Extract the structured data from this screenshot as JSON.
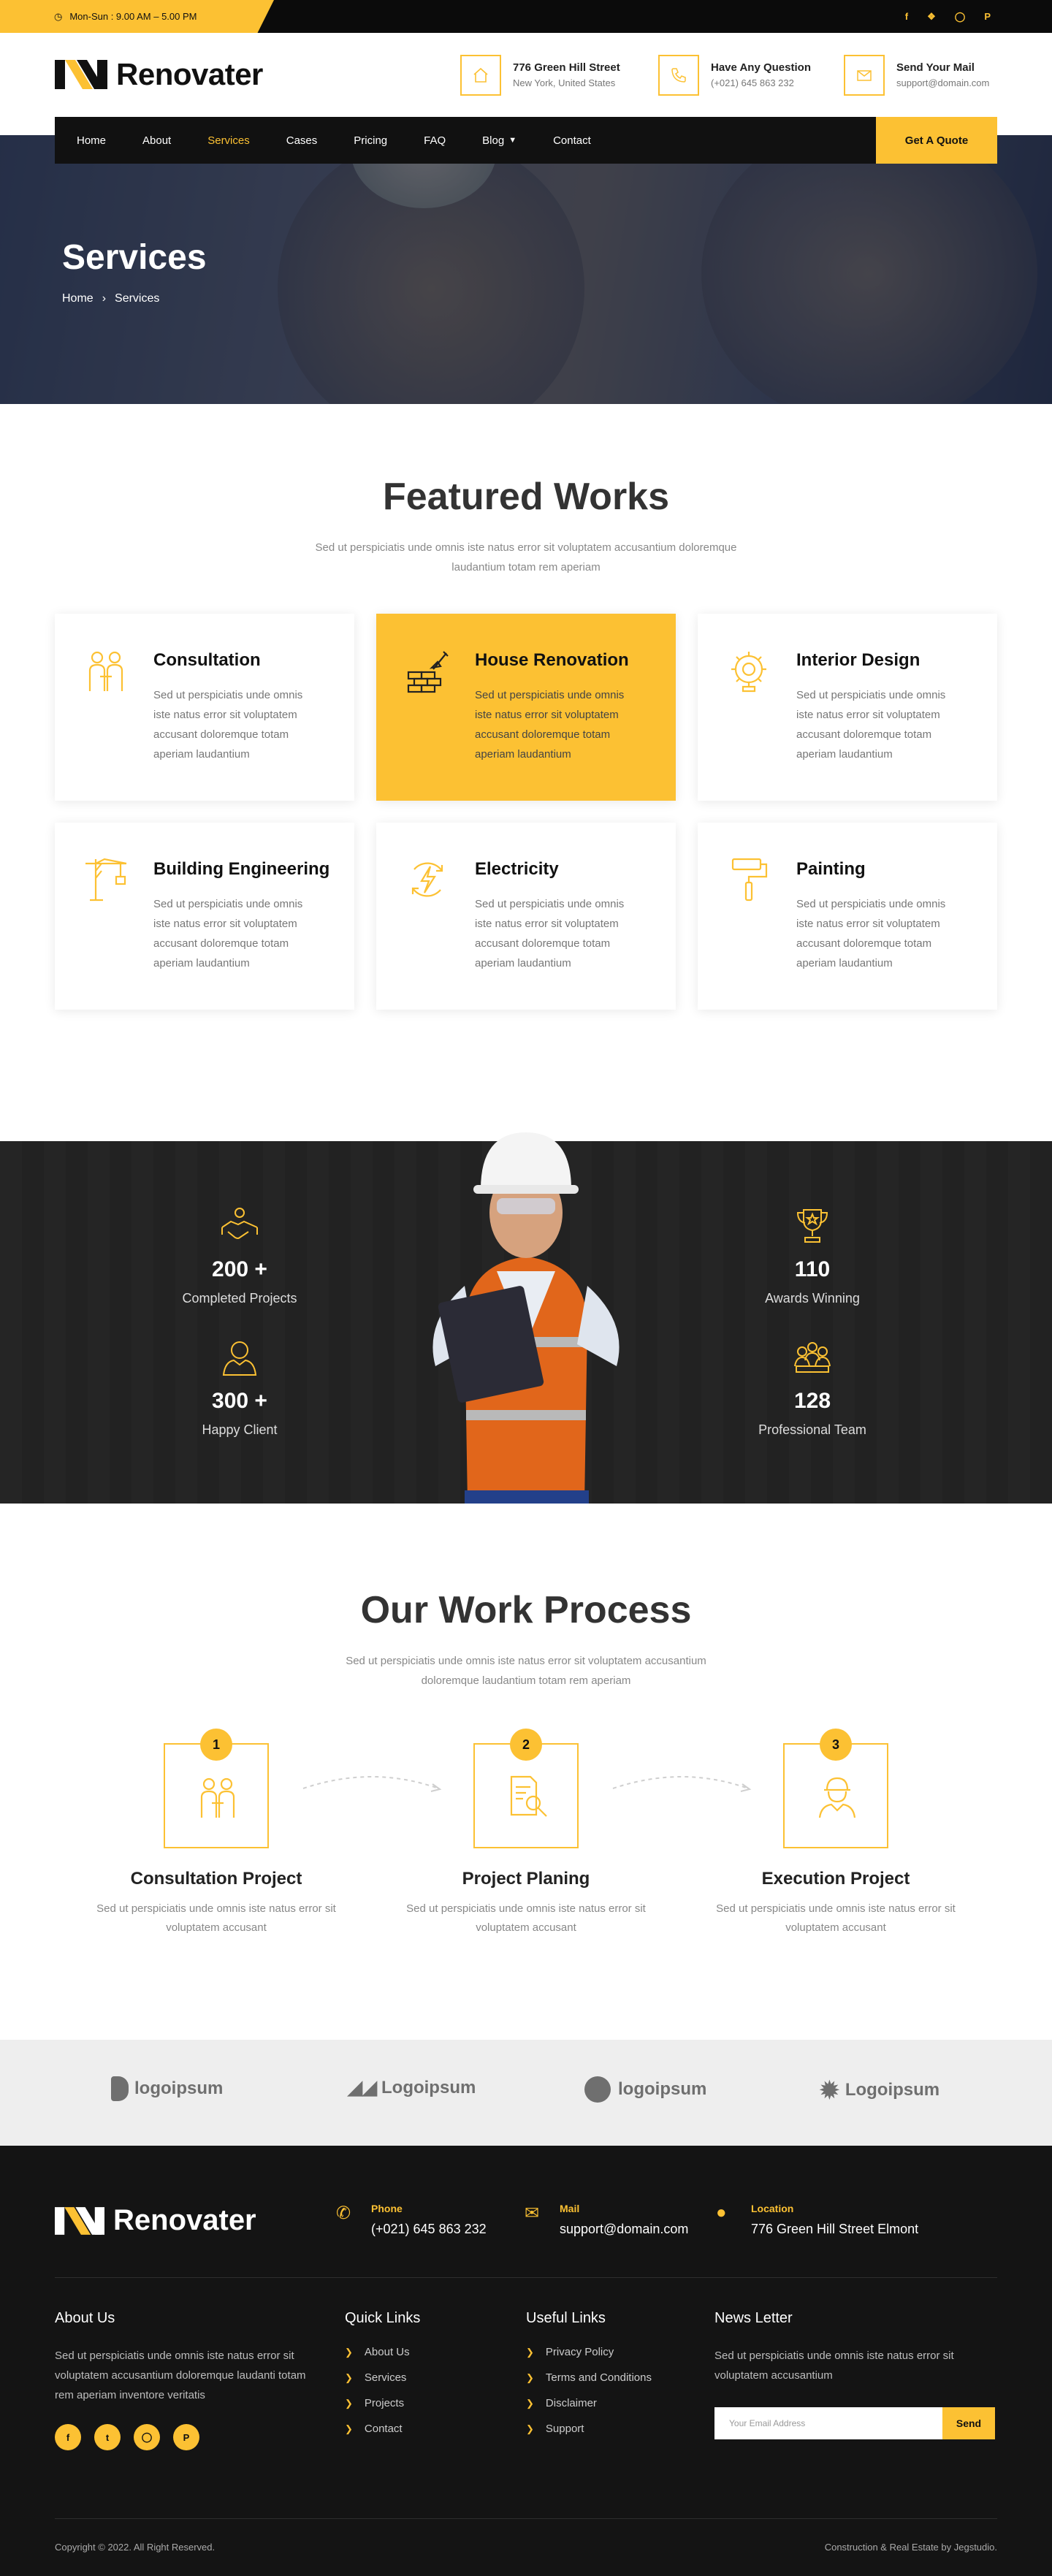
{
  "topbar": {
    "hours": "Mon-Sun : 9.00 AM – 5.00 PM",
    "social_icons": [
      "facebook-icon",
      "twitter-icon",
      "instagram-icon",
      "pinterest-icon"
    ]
  },
  "brand": {
    "name": "Renovater",
    "accent": "#fcc133"
  },
  "header_info": [
    {
      "icon": "home-icon",
      "title": "776 Green Hill Street",
      "sub": "New York, United States"
    },
    {
      "icon": "phone-icon",
      "title": "Have Any Question",
      "sub": "(+021) 645 863 232"
    },
    {
      "icon": "mail-icon",
      "title": "Send Your Mail",
      "sub": "support@domain.com"
    }
  ],
  "nav": {
    "items": [
      "Home",
      "About",
      "Services",
      "Cases",
      "Pricing",
      "FAQ",
      "Blog",
      "Contact"
    ],
    "active": "Services",
    "quote": "Get A Quote"
  },
  "hero": {
    "title": "Services",
    "crumb_home": "Home",
    "crumb_current": "Services"
  },
  "featured": {
    "title": "Featured Works",
    "sub": "Sed ut perspiciatis unde omnis iste natus error sit voluptatem accusantium doloremque laudantium totam rem aperiam",
    "cards": [
      {
        "title": "Consultation",
        "icon": "consultation-icon",
        "text": "Sed ut perspiciatis unde omnis iste natus error sit voluptatem accusant doloremque totam aperiam laudantium"
      },
      {
        "title": "House Renovation",
        "icon": "brick-wall-icon",
        "text": "Sed ut perspiciatis unde omnis iste natus error sit voluptatem accusant doloremque totam aperiam laudantium"
      },
      {
        "title": "Interior Design",
        "icon": "gear-brain-icon",
        "text": "Sed ut perspiciatis unde omnis iste natus error sit voluptatem accusant doloremque totam aperiam laudantium"
      },
      {
        "title": "Building Engineering",
        "icon": "crane-icon",
        "text": "Sed ut perspiciatis unde omnis iste natus error sit voluptatem accusant doloremque totam aperiam laudantium"
      },
      {
        "title": "Electricity",
        "icon": "lightning-icon",
        "text": "Sed ut perspiciatis unde omnis iste natus error sit voluptatem accusant doloremque totam aperiam laudantium"
      },
      {
        "title": "Painting",
        "icon": "paint-roller-icon",
        "text": "Sed ut perspiciatis unde omnis iste natus error sit voluptatem accusant doloremque totam aperiam laudantium"
      }
    ]
  },
  "stats": [
    {
      "num": "200 +",
      "label": "Completed Projects",
      "icon": "handshake-icon"
    },
    {
      "num": "300 +",
      "label": "Happy Client",
      "icon": "user-icon"
    },
    {
      "num": "110",
      "label": "Awards Winning",
      "icon": "trophy-icon"
    },
    {
      "num": "128",
      "label": "Professional Team",
      "icon": "team-icon"
    }
  ],
  "process": {
    "title": "Our Work Process",
    "sub": "Sed ut perspiciatis unde omnis iste natus error sit voluptatem accusantium doloremque laudantium totam rem aperiam",
    "steps": [
      {
        "n": "1",
        "title": "Consultation Project",
        "text": "Sed ut perspiciatis unde omnis iste natus error sit voluptatem accusant"
      },
      {
        "n": "2",
        "title": "Project Planing",
        "text": "Sed ut perspiciatis unde omnis iste natus error sit voluptatem accusant"
      },
      {
        "n": "3",
        "title": "Execution Project",
        "text": "Sed ut perspiciatis unde omnis iste natus error sit voluptatem accusant"
      }
    ]
  },
  "partners": [
    "logoipsum",
    "Logoipsum",
    "logoipsum",
    "Logoipsum"
  ],
  "footer": {
    "contacts": [
      {
        "label": "Phone",
        "value": "(+021) 645 863 232"
      },
      {
        "label": "Mail",
        "value": "support@domain.com"
      },
      {
        "label": "Location",
        "value": "776 Green Hill Street Elmont"
      }
    ],
    "about_title": "About Us",
    "about_text": "Sed ut perspiciatis unde omnis iste natus error sit voluptatem accusantium doloremque laudanti totam rem aperiam inventore veritatis",
    "quick_title": "Quick Links",
    "quick": [
      "About Us",
      "Services",
      "Projects",
      "Contact"
    ],
    "useful_title": "Useful Links",
    "useful": [
      "Privacy Policy",
      "Terms and Conditions",
      "Disclaimer",
      "Support"
    ],
    "news_title": "News Letter",
    "news_text": "Sed ut perspiciatis unde omnis iste natus error sit voluptatem accusantium",
    "email_placeholder": "Your Email Address",
    "send": "Send",
    "copyright": "Copyright © 2022. All Right Reserved.",
    "credit": "Construction & Real Estate by Jegstudio."
  }
}
